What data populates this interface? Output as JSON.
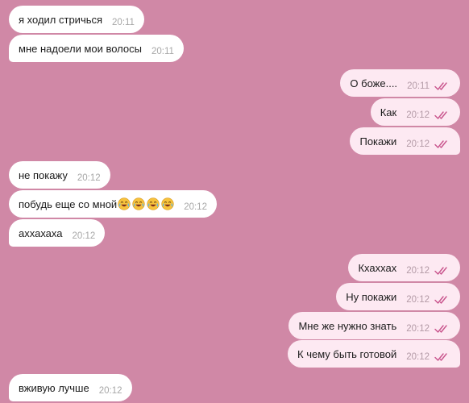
{
  "messages": [
    {
      "text": "я ходил стричься",
      "time": "20:11",
      "direction": "incoming"
    },
    {
      "text": "мне надоели мои волосы",
      "time": "20:11",
      "direction": "incoming"
    },
    {
      "text": "О боже....",
      "time": "20:11",
      "direction": "outgoing",
      "status": "read"
    },
    {
      "text": "Как",
      "time": "20:12",
      "direction": "outgoing",
      "status": "read"
    },
    {
      "text": "Покажи",
      "time": "20:12",
      "direction": "outgoing",
      "status": "read"
    },
    {
      "text": "не покажу",
      "time": "20:12",
      "direction": "incoming"
    },
    {
      "text": "побудь еще со мной",
      "time": "20:12",
      "direction": "incoming",
      "emoji_count": 4,
      "emoji_icon": "crying-laughing-face-icon"
    },
    {
      "text": "аххахаха",
      "time": "20:12",
      "direction": "incoming"
    },
    {
      "text": "Кхаххах",
      "time": "20:12",
      "direction": "outgoing",
      "status": "read"
    },
    {
      "text": "Ну покажи",
      "time": "20:12",
      "direction": "outgoing",
      "status": "read"
    },
    {
      "text": "Мне же нужно знать",
      "time": "20:12",
      "direction": "outgoing",
      "status": "read"
    },
    {
      "text": "К чему быть готовой",
      "time": "20:12",
      "direction": "outgoing",
      "status": "read"
    },
    {
      "text": "вживую лучше",
      "time": "20:12",
      "direction": "incoming"
    }
  ],
  "colors": {
    "background": "#d088a6",
    "incoming_bubble": "#ffffff",
    "outgoing_bubble": "#fde9f2",
    "read_checks": "#c8528b"
  }
}
